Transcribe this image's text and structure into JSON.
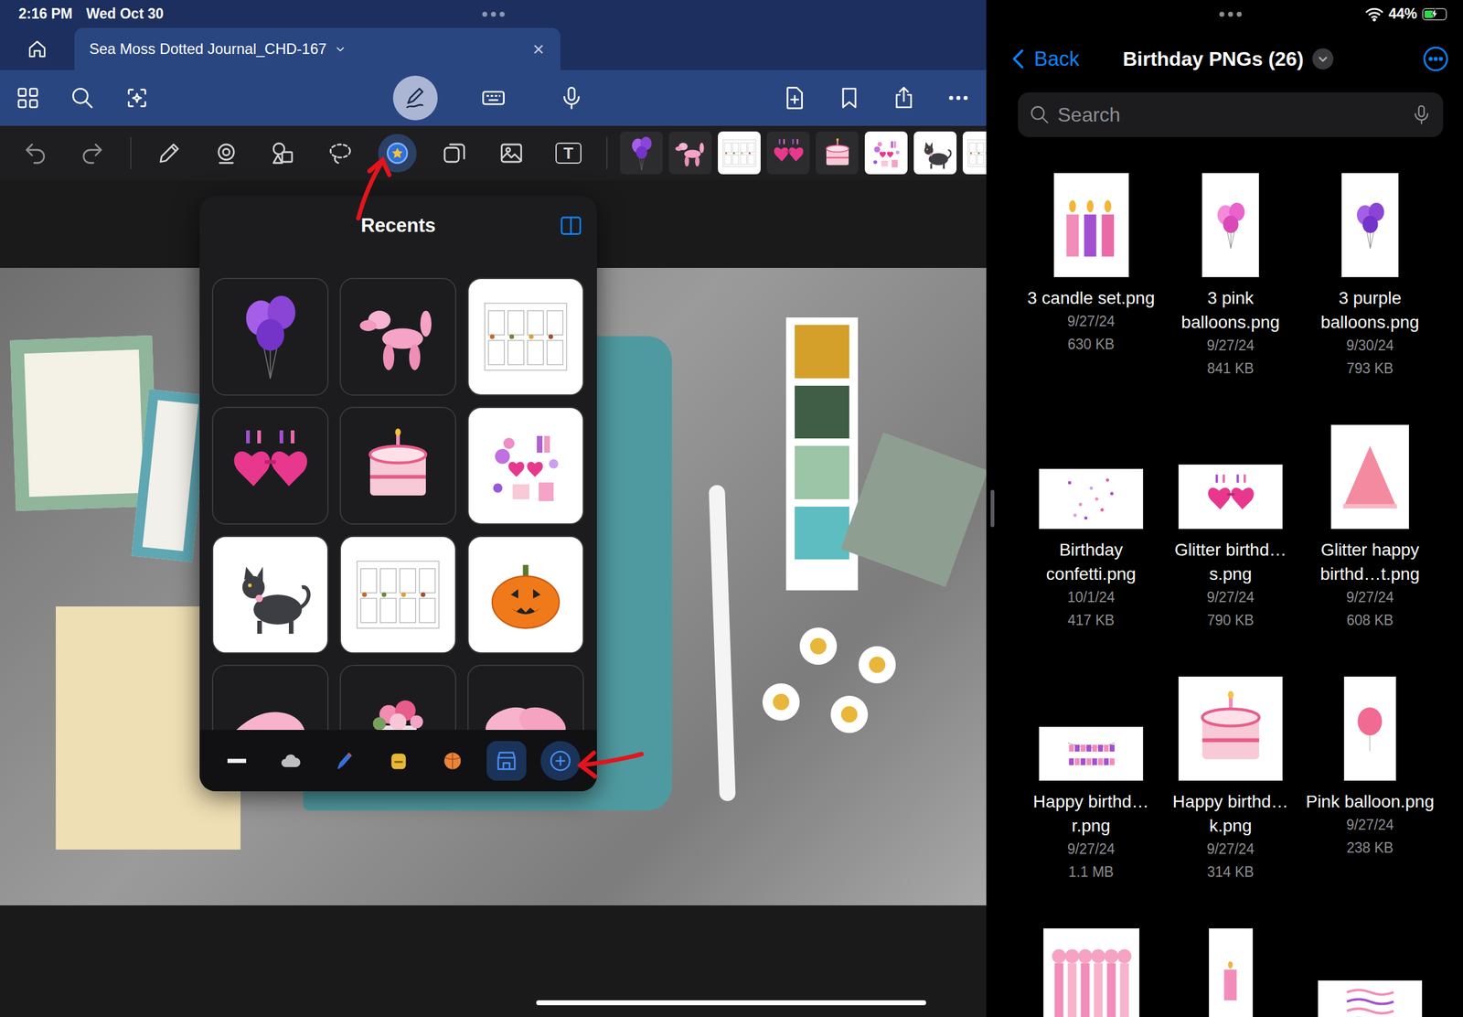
{
  "left_status": {
    "time": "2:16 PM",
    "date": "Wed Oct 30"
  },
  "document_tab": {
    "title": "Sea Moss  Dotted Journal_CHD-167",
    "close": "×"
  },
  "top_tools": {
    "left": [
      {
        "kind": "grid"
      },
      {
        "kind": "search"
      },
      {
        "kind": "magic-lasso"
      }
    ],
    "center": [
      {
        "kind": "pen-mode",
        "selected": true
      },
      {
        "kind": "keyboard",
        "selected": false
      },
      {
        "kind": "mic",
        "selected": false
      }
    ],
    "right": [
      {
        "kind": "add-page"
      },
      {
        "kind": "bookmark"
      },
      {
        "kind": "share"
      },
      {
        "kind": "more"
      }
    ]
  },
  "history": [
    {
      "kind": "undo"
    },
    {
      "kind": "redo"
    }
  ],
  "tools": [
    {
      "kind": "pencil",
      "selected": false
    },
    {
      "kind": "eraser",
      "selected": false
    },
    {
      "kind": "shapes",
      "selected": false
    },
    {
      "kind": "lasso",
      "selected": false
    },
    {
      "kind": "sticker",
      "selected": true
    },
    {
      "kind": "sticky",
      "selected": false
    },
    {
      "kind": "image",
      "selected": false
    },
    {
      "kind": "text",
      "selected": false,
      "glyph": "T"
    }
  ],
  "tool_stickers": [
    {
      "kind": "purple-balloons"
    },
    {
      "kind": "balloon-dog"
    },
    {
      "kind": "planner"
    },
    {
      "kind": "glasses"
    },
    {
      "kind": "cake"
    },
    {
      "kind": "collage"
    },
    {
      "kind": "cat"
    },
    {
      "kind": "planner"
    }
  ],
  "sticker_panel": {
    "title": "Recents",
    "stickers": [
      {
        "kind": "purple-balloons"
      },
      {
        "kind": "balloon-dog"
      },
      {
        "kind": "planner"
      },
      {
        "kind": "glasses"
      },
      {
        "kind": "cake"
      },
      {
        "kind": "collage"
      },
      {
        "kind": "cat"
      },
      {
        "kind": "planner"
      },
      {
        "kind": "pumpkin"
      },
      {
        "kind": "ribbon"
      },
      {
        "kind": "flowers"
      },
      {
        "kind": "butterfly"
      }
    ],
    "categories": [
      {
        "kind": "washi",
        "selected": false
      },
      {
        "kind": "cloud",
        "selected": false
      },
      {
        "kind": "pen",
        "selected": false
      },
      {
        "kind": "badge",
        "selected": false
      },
      {
        "kind": "ball",
        "selected": false
      },
      {
        "kind": "store",
        "selected": true
      },
      {
        "kind": "add",
        "selected": false
      }
    ]
  },
  "right_status": {
    "battery": "44%",
    "battery_level": 0.44,
    "charging": true
  },
  "files_header": {
    "back": "Back",
    "title": "Birthday PNGs (26)"
  },
  "search": {
    "placeholder": "Search"
  },
  "files": [
    {
      "name": "3 candle set.png",
      "date": "9/27/24",
      "size": "630 KB",
      "kind": "candles"
    },
    {
      "name": "3 pink balloons.png",
      "date": "9/27/24",
      "size": "841 KB",
      "kind": "pink-balloons"
    },
    {
      "name": "3 purple balloons.png",
      "date": "9/30/24",
      "size": "793 KB",
      "kind": "purple-balloons"
    },
    {
      "name": "Birthday confetti.png",
      "date": "10/1/24",
      "size": "417 KB",
      "kind": "confetti"
    },
    {
      "name": "Glitter birthd…s.png",
      "date": "9/27/24",
      "size": "790 KB",
      "kind": "glasses"
    },
    {
      "name": "Glitter happy birthd…t.png",
      "date": "9/27/24",
      "size": "608 KB",
      "kind": "hat"
    },
    {
      "name": "Happy birthd…r.png",
      "date": "9/27/24",
      "size": "1.1 MB",
      "kind": "banner"
    },
    {
      "name": "Happy birthd…k.png",
      "date": "9/27/24",
      "size": "314 KB",
      "kind": "cake"
    },
    {
      "name": "Pink balloon.png",
      "date": "9/27/24",
      "size": "238 KB",
      "kind": "balloon"
    }
  ],
  "more_files": [
    {
      "kind": "fringe"
    },
    {
      "kind": "candle"
    },
    {
      "kind": "pattern"
    }
  ]
}
